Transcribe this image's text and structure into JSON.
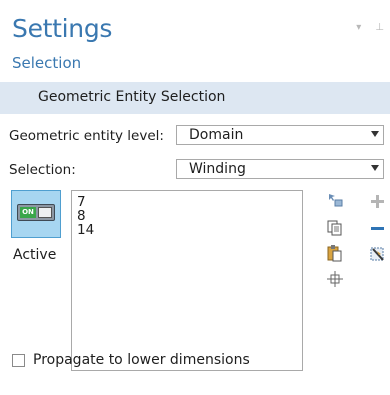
{
  "panel": {
    "title": "Settings",
    "subtitle": "Selection"
  },
  "section": {
    "label": "Geometric Entity Selection"
  },
  "entity_level": {
    "label": "Geometric entity level:",
    "value": "Domain"
  },
  "selection": {
    "label": "Selection:",
    "value": "Winding"
  },
  "active": {
    "toggle_text": "ON",
    "label": "Active"
  },
  "selection_list": {
    "items": [
      "7",
      "8",
      "14"
    ]
  },
  "propagate": {
    "label": "Propagate to lower dimensions",
    "checked": false
  },
  "colors": {
    "accent": "#3a78b0",
    "section_bg": "#dde7f2",
    "active_bg": "#a7d6f1"
  }
}
